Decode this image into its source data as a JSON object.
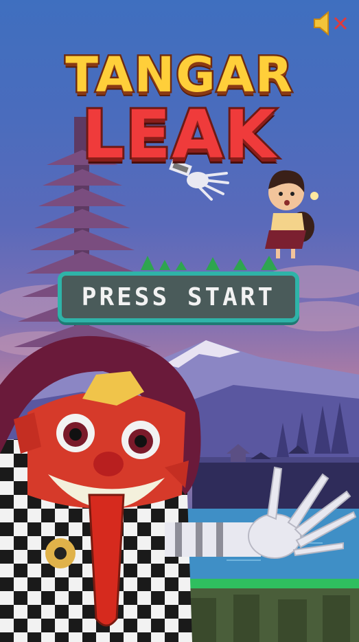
{
  "game": {
    "title_line1": "TANGAR",
    "title_line2": "LEAK",
    "start_label": "PRESS START"
  },
  "sound": {
    "icon": "speaker-muted-icon",
    "muted": true
  },
  "colors": {
    "title_yellow": "#ffcf3a",
    "title_red": "#ef3b3b",
    "button_fill": "#4a5b5a",
    "button_border": "#2fb3a8"
  }
}
